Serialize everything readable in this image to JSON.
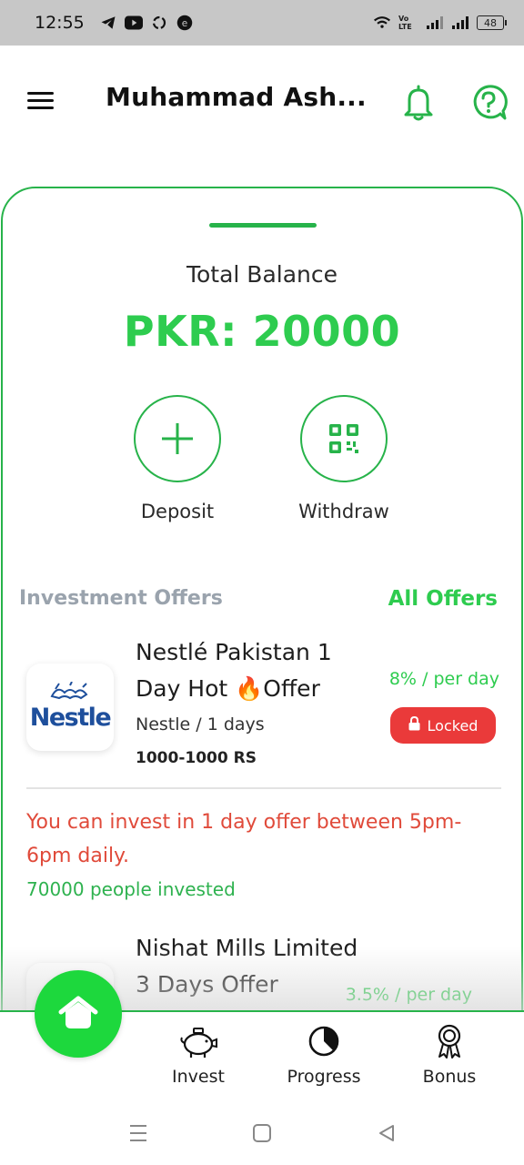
{
  "status_bar": {
    "time": "12:55",
    "battery": "48",
    "network": "Vo LTE"
  },
  "header": {
    "title": "Muhammad Ash..."
  },
  "balance": {
    "label": "Total Balance",
    "value": "PKR: 20000"
  },
  "actions": {
    "deposit": "Deposit",
    "withdraw": "Withdraw"
  },
  "offers_section": {
    "title": "Investment Offers",
    "link": "All Offers"
  },
  "offers": [
    {
      "name": "Nestlé Pakistan 1 Day Hot 🔥Offer",
      "meta": "Nestle / 1 days",
      "range": "1000-1000 RS",
      "rate": "8% / per day",
      "status": "Locked",
      "note": "You can invest in 1 day offer between 5pm-6pm daily.",
      "invested": "70000 people invested",
      "logo_text": "Nestle"
    },
    {
      "name": "Nishat Mills Limited 3 Days Offer",
      "rate": "3.5% / per day"
    }
  ],
  "bottom_nav": {
    "invest": "Invest",
    "progress": "Progress",
    "bonus": "Bonus"
  },
  "colors": {
    "accent": "#2ecc4f",
    "border": "#27b34a",
    "danger": "#ea3a3a",
    "fab": "#1dd83d"
  }
}
